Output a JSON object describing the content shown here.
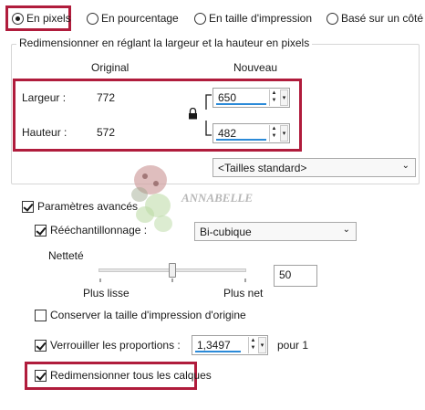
{
  "resize_mode": {
    "options": [
      {
        "label": "En pixels",
        "selected": true
      },
      {
        "label": "En pourcentage",
        "selected": false
      },
      {
        "label": "En taille d'impression",
        "selected": false
      },
      {
        "label": "Basé sur un côté",
        "selected": false
      }
    ]
  },
  "dimensions_group": {
    "title": "Redimensionner en réglant la largeur et la hauteur en pixels",
    "col_original": "Original",
    "col_new": "Nouveau",
    "width_label": "Largeur :",
    "width_original": "772",
    "width_new": "650",
    "height_label": "Hauteur :",
    "height_original": "572",
    "height_new": "482",
    "preset": "<Tailles standard>"
  },
  "watermark": "ANNABELLE",
  "advanced": {
    "label": "Paramètres avancés",
    "checked": true,
    "resample_label": "Rééchantillonnage :",
    "resample_checked": true,
    "resample_method": "Bi-cubique",
    "sharpness_label": "Netteté",
    "sharpness_value": "50",
    "sharpness_level": 0.5,
    "slider_min_label": "Plus lisse",
    "slider_max_label": "Plus net",
    "keep_print_size_label": "Conserver la taille d'impression d'origine",
    "keep_print_size_checked": false,
    "lock_ratio_label": "Verrouiller les proportions :",
    "lock_ratio_checked": true,
    "ratio_value": "1,3497",
    "ratio_suffix": "pour 1",
    "resize_all_layers_label": "Redimensionner tous les calques",
    "resize_all_layers_checked": true
  },
  "colors": {
    "highlight": "#b01c3c",
    "accent_underline": "#2b8ad8"
  }
}
